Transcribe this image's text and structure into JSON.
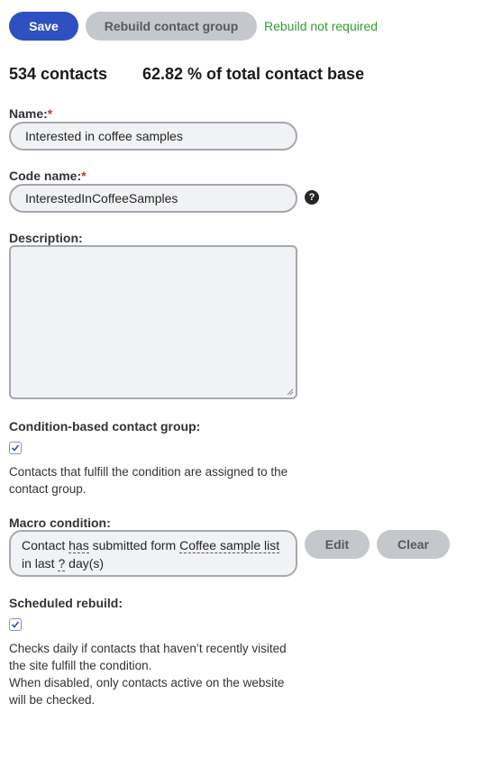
{
  "toolbar": {
    "save_label": "Save",
    "rebuild_label": "Rebuild contact group",
    "status_text": "Rebuild not required"
  },
  "stats": {
    "contacts": "534 contacts",
    "percent": "62.82 % of total contact base"
  },
  "name": {
    "label": "Name:",
    "required_mark": "*",
    "value": "Interested in coffee samples"
  },
  "code_name": {
    "label": "Code name:",
    "required_mark": "*",
    "value": "InterestedInCoffeeSamples",
    "help_glyph": "?"
  },
  "description": {
    "label": "Description:",
    "value": ""
  },
  "condition_group": {
    "label": "Condition-based contact group:",
    "checked": true,
    "description": "Contacts that fulfill the condition are assigned to the contact group."
  },
  "macro": {
    "label": "Macro condition:",
    "w1": "Contact ",
    "k1": "has",
    "w2": " submitted form ",
    "k2": "Coffee sample list",
    "w3": " in last ",
    "k3": "?",
    "w4": " day(s)",
    "edit_label": "Edit",
    "clear_label": "Clear"
  },
  "scheduled": {
    "label": "Scheduled rebuild:",
    "checked": true,
    "line1": "Checks daily if contacts that haven’t recently visited the site fulfill the condition.",
    "line2": "When disabled, only contacts active on the website will be checked."
  },
  "colors": {
    "primary": "#2f50c0",
    "secondary": "#c4c7cc",
    "status_ok": "#2e9e2e",
    "required": "#d03030"
  }
}
